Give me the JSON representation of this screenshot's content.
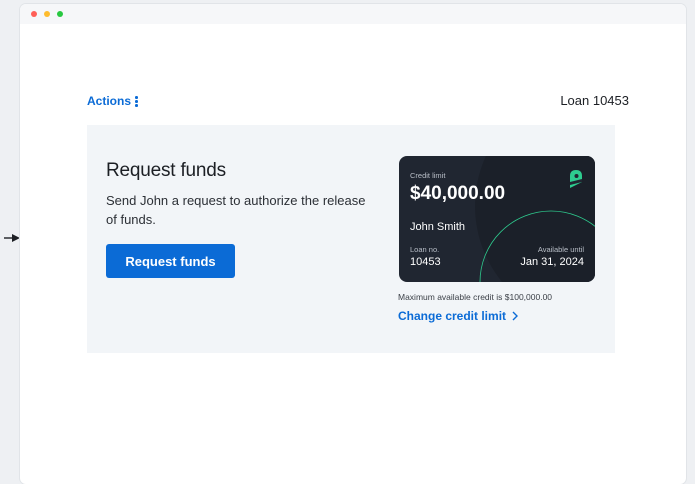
{
  "header": {
    "actions_label": "Actions",
    "loan_title": "Loan 10453"
  },
  "request": {
    "title": "Request funds",
    "description": "Send John a request to authorize the release of funds.",
    "button_label": "Request funds"
  },
  "card": {
    "credit_limit_label": "Credit limit",
    "credit_limit_value": "$40,000.00",
    "holder_name": "John Smith",
    "loan_no_label": "Loan no.",
    "loan_no_value": "10453",
    "available_until_label": "Available until",
    "available_until_value": "Jan 31, 2024"
  },
  "credit_note": "Maximum available credit is $100,000.00",
  "change_link_label": "Change credit limit",
  "colors": {
    "accent": "#0b6bd6",
    "card_bg": "#202631",
    "logo_green": "#2ecc8f",
    "panel_bg": "#f2f5f8"
  },
  "icons": [
    "kebab-icon",
    "brand-logo-icon",
    "chevron-right-icon",
    "arrow-right-icon"
  ]
}
